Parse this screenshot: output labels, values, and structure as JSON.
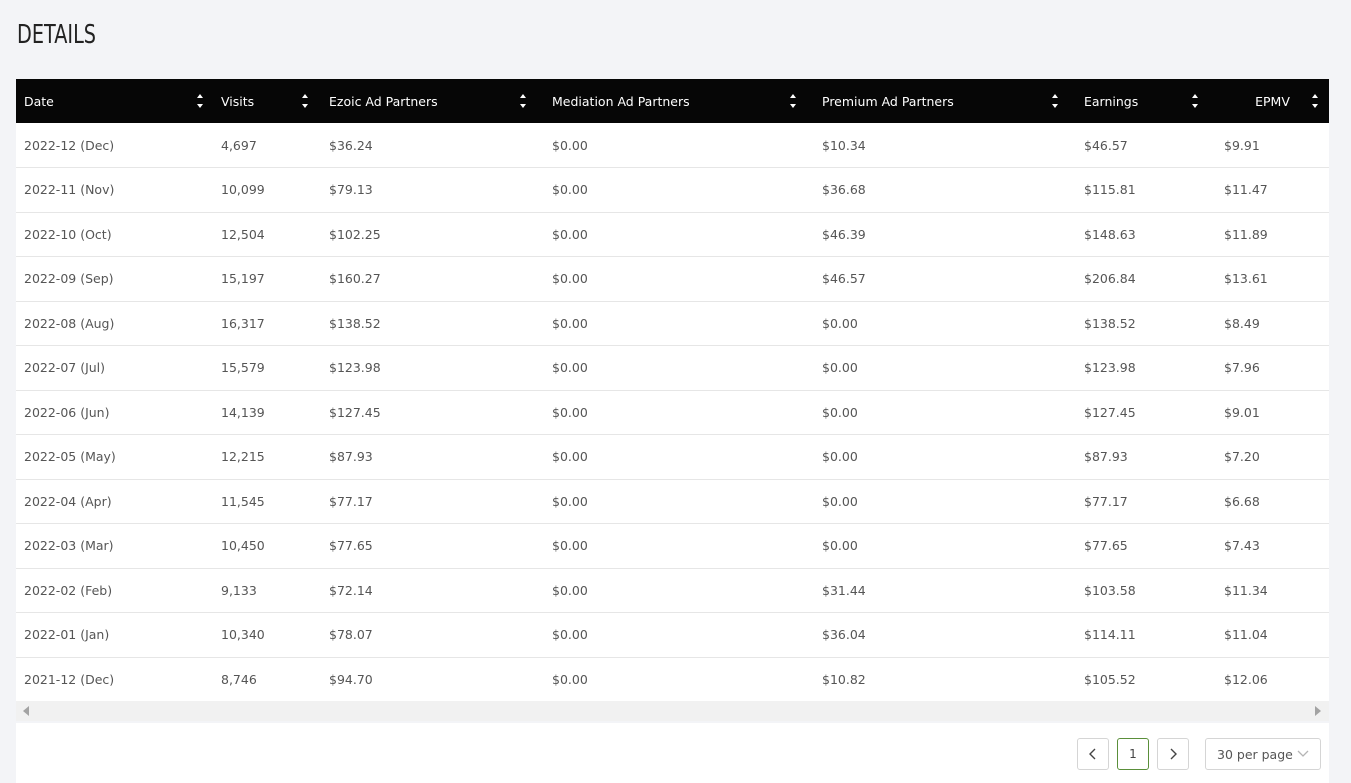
{
  "page": {
    "title": "DETAILS"
  },
  "table": {
    "columns": [
      {
        "label": "Date"
      },
      {
        "label": "Visits"
      },
      {
        "label": "Ezoic Ad Partners"
      },
      {
        "label": "Mediation Ad Partners"
      },
      {
        "label": "Premium Ad Partners"
      },
      {
        "label": "Earnings"
      },
      {
        "label": "EPMV"
      }
    ],
    "rows": [
      [
        "2022-12 (Dec)",
        "4,697",
        "$36.24",
        "$0.00",
        "$10.34",
        "$46.57",
        "$9.91"
      ],
      [
        "2022-11 (Nov)",
        "10,099",
        "$79.13",
        "$0.00",
        "$36.68",
        "$115.81",
        "$11.47"
      ],
      [
        "2022-10 (Oct)",
        "12,504",
        "$102.25",
        "$0.00",
        "$46.39",
        "$148.63",
        "$11.89"
      ],
      [
        "2022-09 (Sep)",
        "15,197",
        "$160.27",
        "$0.00",
        "$46.57",
        "$206.84",
        "$13.61"
      ],
      [
        "2022-08 (Aug)",
        "16,317",
        "$138.52",
        "$0.00",
        "$0.00",
        "$138.52",
        "$8.49"
      ],
      [
        "2022-07 (Jul)",
        "15,579",
        "$123.98",
        "$0.00",
        "$0.00",
        "$123.98",
        "$7.96"
      ],
      [
        "2022-06 (Jun)",
        "14,139",
        "$127.45",
        "$0.00",
        "$0.00",
        "$127.45",
        "$9.01"
      ],
      [
        "2022-05 (May)",
        "12,215",
        "$87.93",
        "$0.00",
        "$0.00",
        "$87.93",
        "$7.20"
      ],
      [
        "2022-04 (Apr)",
        "11,545",
        "$77.17",
        "$0.00",
        "$0.00",
        "$77.17",
        "$6.68"
      ],
      [
        "2022-03 (Mar)",
        "10,450",
        "$77.65",
        "$0.00",
        "$0.00",
        "$77.65",
        "$7.43"
      ],
      [
        "2022-02 (Feb)",
        "9,133",
        "$72.14",
        "$0.00",
        "$31.44",
        "$103.58",
        "$11.34"
      ],
      [
        "2022-01 (Jan)",
        "10,340",
        "$78.07",
        "$0.00",
        "$36.04",
        "$114.11",
        "$11.04"
      ],
      [
        "2021-12 (Dec)",
        "8,746",
        "$94.70",
        "$0.00",
        "$10.82",
        "$105.52",
        "$12.06"
      ]
    ]
  },
  "pagination": {
    "current_page": "1",
    "per_page": "30 per page"
  },
  "colors": {
    "header_bg": "#060606",
    "header_text": "#ffffff",
    "active_page_border": "#5a8f3a",
    "page_bg": "#f3f4f7"
  }
}
